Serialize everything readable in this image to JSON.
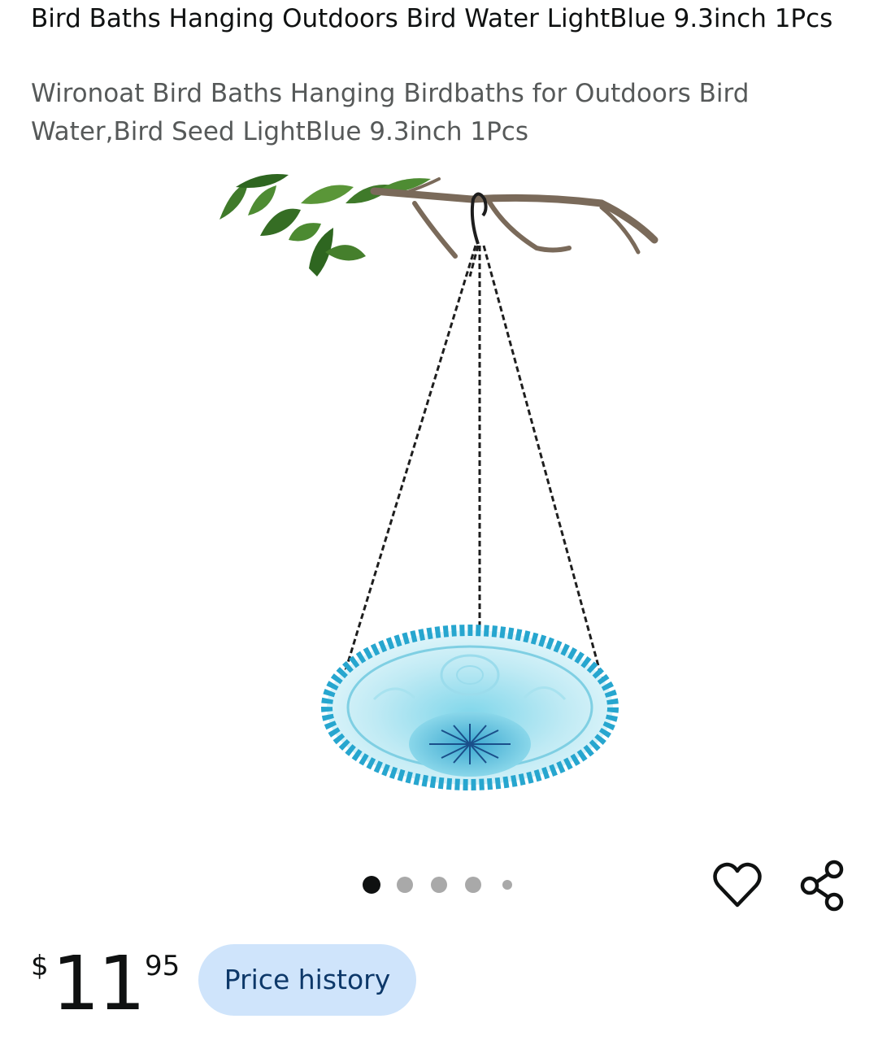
{
  "product": {
    "title": "Bird Baths Hanging Outdoors Bird Water LightBlue 9.3inch 1Pcs",
    "subtitle": "Wironoat Bird Baths Hanging Birdbaths for Outdoors Bird Water,Bird Seed LightBlue 9.3inch 1Pcs"
  },
  "gallery": {
    "image_count": 5,
    "active_index": 0
  },
  "actions": {
    "wishlist_icon": "heart-outline-icon",
    "share_icon": "share-icon"
  },
  "price": {
    "symbol": "$",
    "whole": "11",
    "fraction": "95"
  },
  "price_history": {
    "label": "Price history",
    "background": "#cfe4fb",
    "text_color": "#0d3869"
  }
}
